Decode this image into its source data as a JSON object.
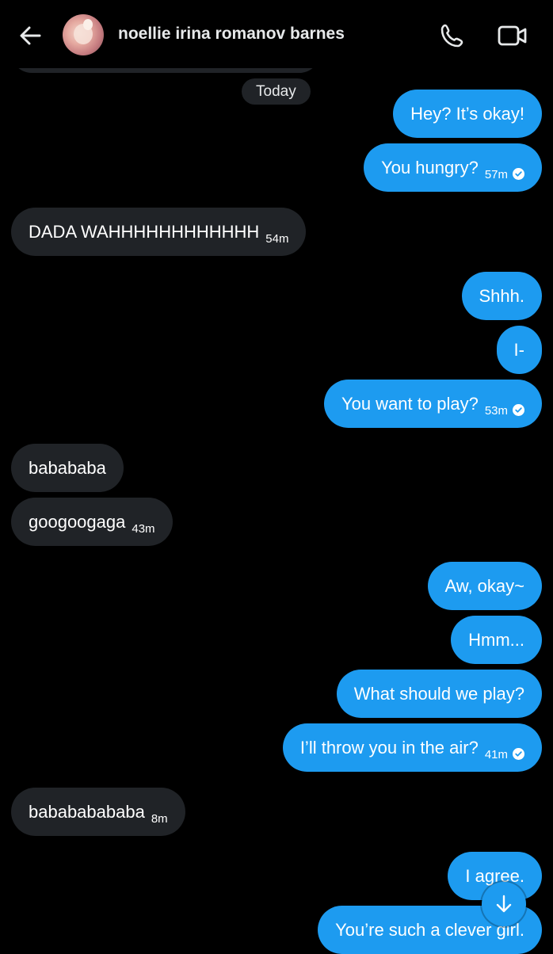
{
  "header": {
    "contact_name": "noellie irina romanov barnes"
  },
  "date_divider": "Today",
  "messages": [
    {
      "dir": "out",
      "text": "Hey? It’s okay!",
      "time": "",
      "read": false
    },
    {
      "dir": "out",
      "text": "You hungry?",
      "time": "57m",
      "read": true
    },
    {
      "dir": "in",
      "text": "DADA WAHHHHHHHHHHHH",
      "time": "54m",
      "read": false
    },
    {
      "dir": "out",
      "text": "Shhh.",
      "time": "",
      "read": false
    },
    {
      "dir": "out",
      "text": "I-",
      "time": "",
      "read": false
    },
    {
      "dir": "out",
      "text": "You want to play?",
      "time": "53m",
      "read": true
    },
    {
      "dir": "in",
      "text": "babababa",
      "time": "",
      "read": false
    },
    {
      "dir": "in",
      "text": "googoogaga",
      "time": "43m",
      "read": false
    },
    {
      "dir": "out",
      "text": "Aw, okay~",
      "time": "",
      "read": false
    },
    {
      "dir": "out",
      "text": "Hmm...",
      "time": "",
      "read": false
    },
    {
      "dir": "out",
      "text": "What should we play?",
      "time": "",
      "read": false
    },
    {
      "dir": "out",
      "text": "I’ll throw you in the air?",
      "time": "41m",
      "read": true
    },
    {
      "dir": "in",
      "text": "babababababa",
      "time": "8m",
      "read": false
    },
    {
      "dir": "out",
      "text": "I agree.",
      "time": "",
      "read": false
    },
    {
      "dir": "out",
      "text": "You’re such a clever girl.",
      "time": "",
      "read": false
    }
  ],
  "icons": {
    "back": "arrow-left-icon",
    "call": "phone-icon",
    "video": "video-camera-icon",
    "scroll": "arrow-down-icon",
    "read": "check-circle-icon"
  },
  "colors": {
    "background": "#000000",
    "outgoing_bubble": "#1d9bf0",
    "incoming_bubble": "#202327",
    "text": "#e7e9ea"
  }
}
